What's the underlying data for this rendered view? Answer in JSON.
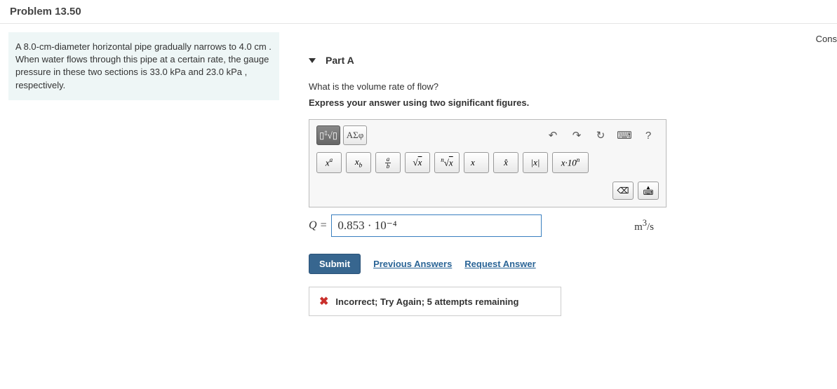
{
  "header": {
    "title": "Problem 13.50"
  },
  "topRight": "Cons",
  "problemStatement": "A 8.0-cm-diameter horizontal pipe gradually narrows to 4.0 cm . When water flows through this pipe at a certain rate, the gauge pressure in these two sections is 33.0 kPa and 23.0 kPa , respectively.",
  "part": {
    "label": "Part A",
    "question": "What is the volume rate of flow?",
    "instruction": "Express your answer using two significant figures."
  },
  "toolbar": {
    "tabs": {
      "math": "√",
      "greek": "ΑΣφ"
    },
    "actions": {
      "undo": "↶",
      "redo": "↷",
      "reset": "↻",
      "keyboard": "⌨",
      "help": "?"
    },
    "mathButtons": {
      "sup": "xᵃ",
      "sub": "xᵦ",
      "frac_top": "a",
      "frac_bot": "b",
      "sqrt": "√x",
      "nroot": "ⁿ√x",
      "vec": "x⃗",
      "hat": "x̂",
      "abs": "|x|",
      "sci": "x·10ⁿ"
    },
    "inputControls": {
      "backspace": "⌫",
      "expand": "⌃"
    }
  },
  "answer": {
    "label": "Q = ",
    "value": "0.853 · 10⁻⁴",
    "units": "m³/s"
  },
  "actions": {
    "submit": "Submit",
    "previous": "Previous Answers",
    "request": "Request Answer"
  },
  "feedback": {
    "icon": "✖",
    "text": "Incorrect; Try Again; 5 attempts remaining"
  }
}
